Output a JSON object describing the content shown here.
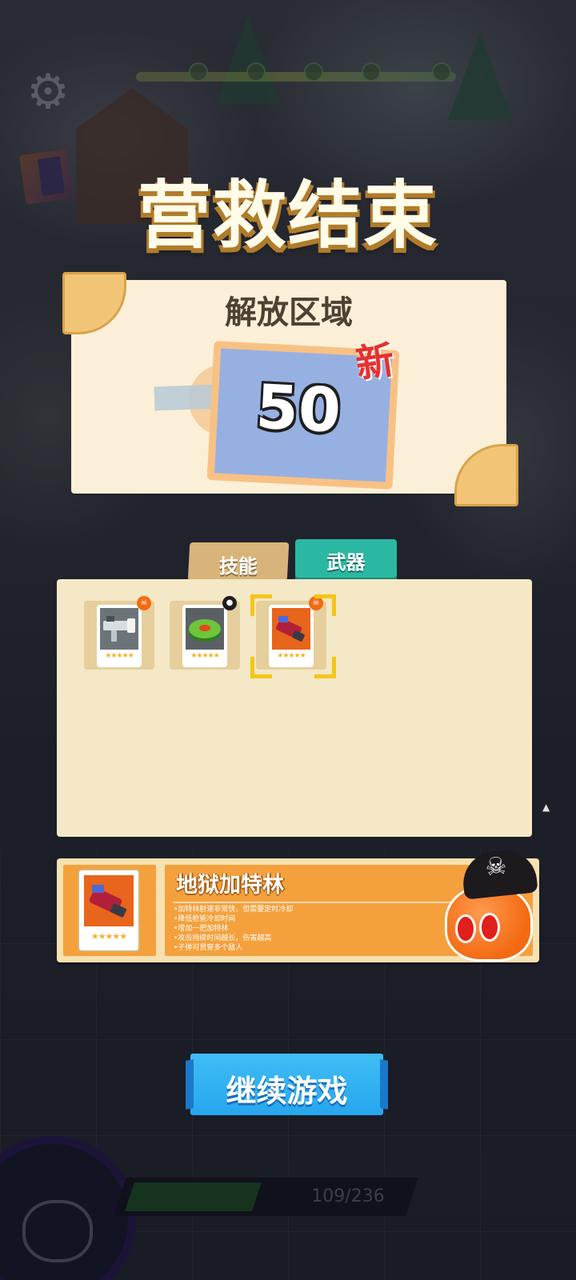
{
  "title": "营救结束",
  "area_panel": {
    "heading": "解放区域",
    "number": "50",
    "new_badge": "新"
  },
  "tabs": [
    {
      "label": "技能",
      "selected": false
    },
    {
      "label": "武器",
      "selected": true
    }
  ],
  "weapons": [
    {
      "icon": "rocket-launcher-icon",
      "stars": "★★★★★",
      "role_icon": "pirate-mascot-icon",
      "selected": false
    },
    {
      "icon": "green-disc-mine-icon",
      "stars": "★★★★★",
      "role_icon": "bomb-mascot-icon",
      "selected": false
    },
    {
      "icon": "gatling-gun-icon",
      "stars": "★★★★★",
      "role_icon": "pirate-mascot-icon",
      "selected": true
    }
  ],
  "detail": {
    "name": "地狱加特林",
    "stars": "★★★★★",
    "description": [
      "•加特林射速非常快，但需要定时冷却",
      "•降低枪管冷却时间",
      "•增加一把加特林",
      "•攻击持续时间越长，伤害越高",
      "•子弹可贯穿多个敌人"
    ]
  },
  "continue_button": "继续游戏",
  "xp": {
    "text": "109/236",
    "current": 109,
    "max": 236
  },
  "colors": {
    "title_text": "#fffbe9",
    "panel_bg": "#fbf0d7",
    "tab_selected": "#2bb8a2",
    "tab_unselected": "#d9b47a",
    "detail_orange": "#f4a13d",
    "button_blue": "#27a6ee",
    "new_red": "#e5322e"
  },
  "icons": {
    "settings": "gear-icon",
    "book": "book-icon"
  }
}
